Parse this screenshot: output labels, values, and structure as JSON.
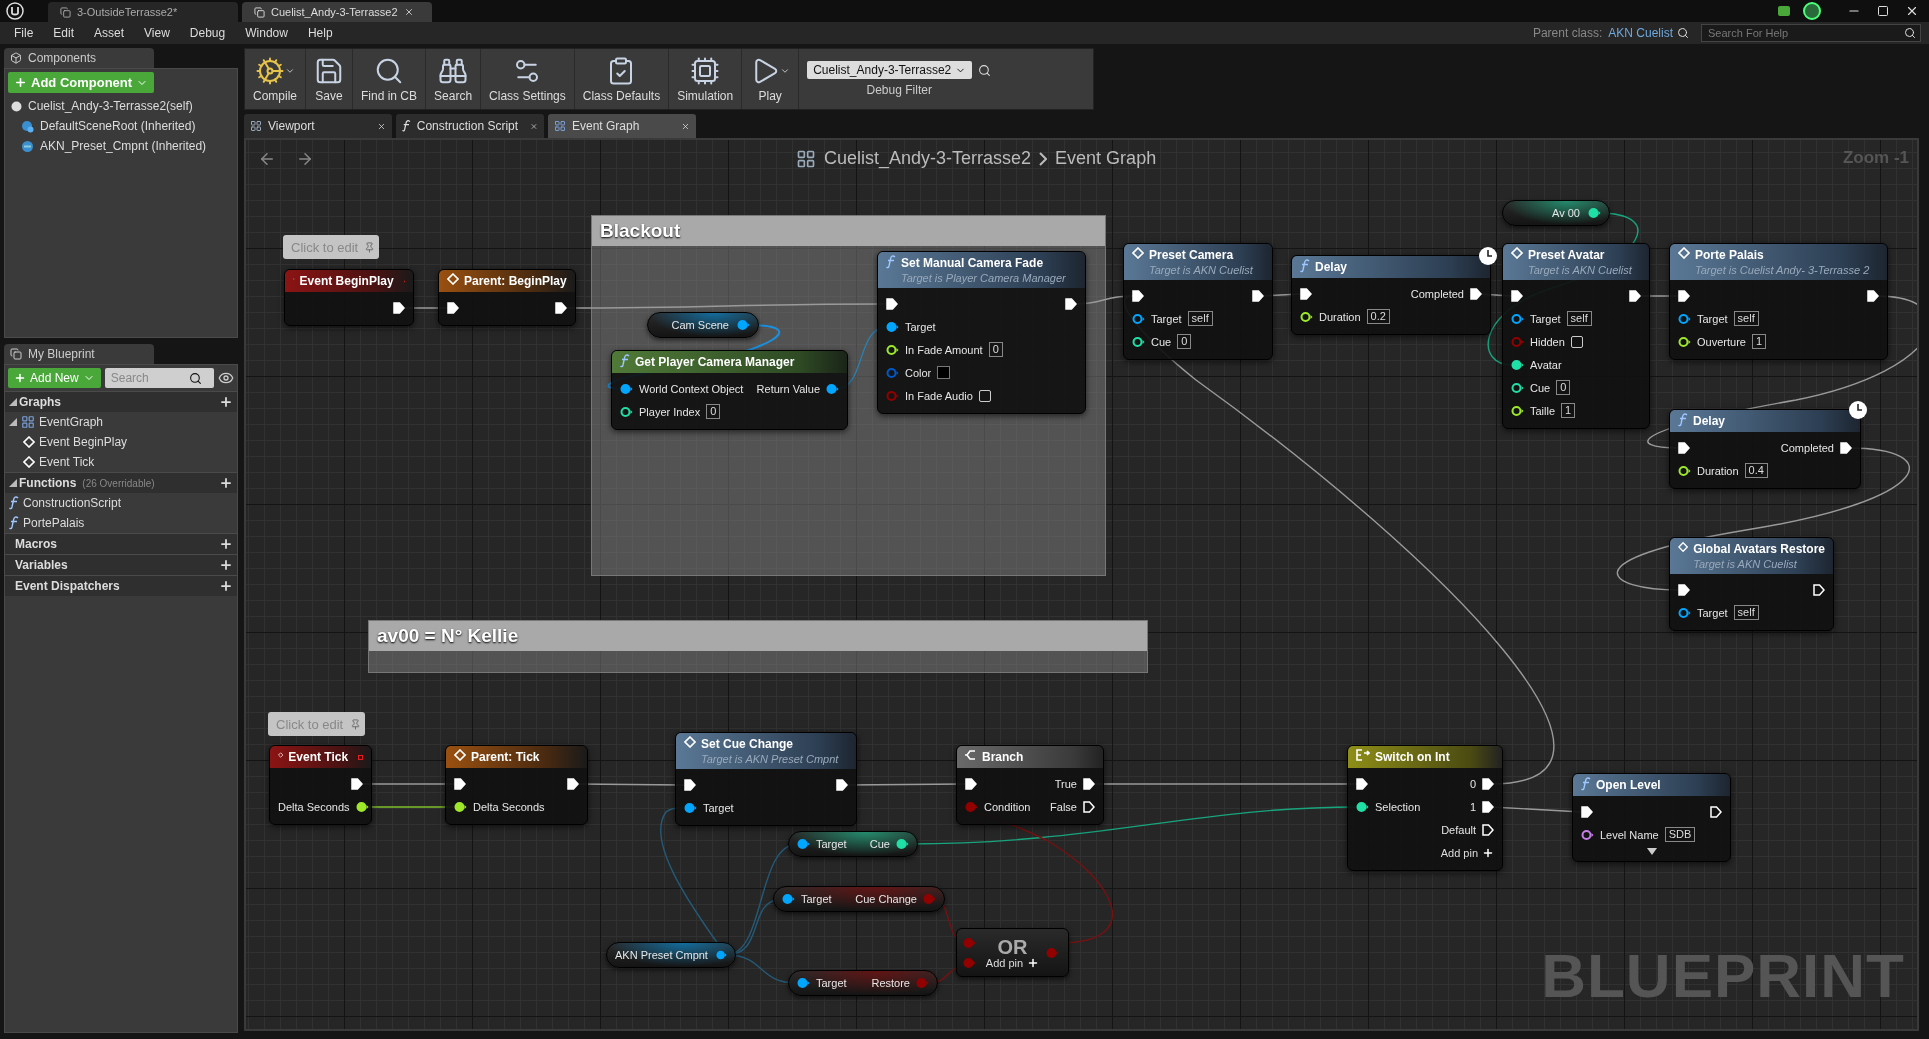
{
  "title_bar": {
    "tabs": [
      {
        "label": "3-OutsideTerrasse2*",
        "selected": false
      },
      {
        "label": "Cuelist_Andy-3-Terrasse2",
        "selected": true
      }
    ]
  },
  "menu": [
    "File",
    "Edit",
    "Asset",
    "View",
    "Debug",
    "Window",
    "Help"
  ],
  "parent_class": {
    "label": "Parent class:",
    "value": "AKN Cuelist"
  },
  "help_search": {
    "placeholder": "Search For Help"
  },
  "components": {
    "title": "Components",
    "add_button": "Add Component",
    "items": [
      {
        "label": "Cuelist_Andy-3-Terrasse2(self)",
        "kind": "self"
      },
      {
        "label": "DefaultSceneRoot (Inherited)",
        "kind": "scene"
      },
      {
        "label": "AKN_Preset_Cmpnt (Inherited)",
        "kind": "component"
      }
    ]
  },
  "my_blueprint": {
    "title": "My Blueprint",
    "add_button": "Add New",
    "search": {
      "placeholder": "Search"
    },
    "sections": [
      {
        "label": "Graphs",
        "expanded": true,
        "items": [
          {
            "label": "EventGraph",
            "kind": "graph",
            "expanded": true,
            "children": [
              {
                "label": "Event BeginPlay",
                "kind": "event"
              },
              {
                "label": "Event Tick",
                "kind": "event"
              }
            ]
          }
        ]
      },
      {
        "label": "Functions",
        "note": "(26 Overridable)",
        "expanded": true,
        "items": [
          {
            "label": "ConstructionScript",
            "kind": "construction"
          },
          {
            "label": "PortePalais",
            "kind": "function"
          }
        ]
      },
      {
        "label": "Macros",
        "expanded": false
      },
      {
        "label": "Variables",
        "expanded": false
      },
      {
        "label": "Event Dispatchers",
        "expanded": false
      }
    ]
  },
  "toolbar": [
    {
      "label": "Compile",
      "kind": "compile",
      "dropdown": true
    },
    {
      "label": "Save",
      "kind": "save",
      "dropdown": false
    },
    {
      "label": "Find in CB",
      "kind": "find",
      "dropdown": false
    },
    {
      "label": "Search",
      "kind": "search",
      "dropdown": false
    },
    {
      "label": "Class Settings",
      "kind": "settings",
      "dropdown": false
    },
    {
      "label": "Class Defaults",
      "kind": "defaults",
      "dropdown": false
    },
    {
      "label": "Simulation",
      "kind": "simulation",
      "dropdown": false
    },
    {
      "label": "Play",
      "kind": "play",
      "dropdown": true
    }
  ],
  "debug_filter": {
    "value": "Cuelist_Andy-3-Terrasse2",
    "label": "Debug Filter"
  },
  "graph_tabs": [
    {
      "label": "Viewport",
      "kind": "viewport",
      "selected": false
    },
    {
      "label": "Construction Script",
      "kind": "function",
      "selected": false
    },
    {
      "label": "Event Graph",
      "kind": "graph",
      "selected": true
    }
  ],
  "graph": {
    "breadcrumb": [
      "Cuelist_Andy-3-Terrasse2",
      "Event Graph"
    ],
    "zoom": "Zoom -1",
    "watermark": "BLUEPRINT",
    "comments": [
      {
        "title": "Blackout"
      },
      {
        "title": "av00 =  N° Kellie"
      }
    ],
    "bubbles": [
      {
        "text": "Click to edit"
      },
      {
        "text": "Click to edit"
      }
    ],
    "nodes": [
      {
        "kind": "event",
        "title": "Event BeginPlay",
        "rows": [
          {
            "right": {
              "kind": "exec",
              "connected": true
            }
          }
        ]
      },
      {
        "kind": "parent",
        "title": "Parent: BeginPlay",
        "rows": [
          {
            "left": {
              "kind": "exec",
              "connected": true
            },
            "right": {
              "kind": "exec",
              "connected": true
            }
          }
        ]
      },
      {
        "kind": "variable",
        "title": "Cam Scene",
        "output": {
          "kind": "data",
          "color": "#00a6ff",
          "connected": true
        }
      },
      {
        "kind": "pure",
        "title": "Get Player Camera Manager",
        "rows": [
          {
            "left": {
              "kind": "data",
              "label": "World Context Object",
              "color": "#00a6ff",
              "connected": true
            },
            "right": {
              "kind": "data",
              "label": "Return Value",
              "color": "#00a6ff",
              "connected": true
            }
          },
          {
            "left": {
              "kind": "data",
              "label": "Player Index",
              "color": "#1fe0a6",
              "connected": false,
              "value": "0"
            }
          }
        ]
      },
      {
        "kind": "function_call",
        "title": "Set Manual Camera Fade",
        "subtitle": "Target is Player Camera Manager",
        "rows": [
          {
            "left": {
              "kind": "exec",
              "connected": true
            },
            "right": {
              "kind": "exec",
              "connected": true
            }
          },
          {
            "left": {
              "kind": "data",
              "label": "Target",
              "color": "#00a6ff",
              "connected": true
            }
          },
          {
            "left": {
              "kind": "data",
              "label": "In Fade Amount",
              "color": "#9ee82a",
              "connected": false,
              "value": "0"
            }
          },
          {
            "left": {
              "kind": "data",
              "label": "Color",
              "color": "#0058c8",
              "connected": false,
              "default": {
                "color": "#000000"
              }
            }
          },
          {
            "left": {
              "kind": "data",
              "label": "In Fade Audio",
              "color": "#930000",
              "connected": false,
              "checked": false
            }
          }
        ]
      },
      {
        "kind": "event_call",
        "title": "Preset Camera",
        "subtitle": "Target is AKN Cuelist",
        "rows": [
          {
            "left": {
              "kind": "exec",
              "connected": true
            },
            "right": {
              "kind": "exec",
              "connected": true
            }
          },
          {
            "left": {
              "kind": "data",
              "label": "Target",
              "color": "#00a6ff",
              "connected": false,
              "value": "self"
            }
          },
          {
            "left": {
              "kind": "data",
              "label": "Cue",
              "color": "#1fe0a6",
              "connected": false,
              "value": "0"
            }
          }
        ]
      },
      {
        "kind": "function_call",
        "title": "Delay",
        "latent": true,
        "rows": [
          {
            "left": {
              "kind": "exec",
              "connected": true
            },
            "right": {
              "kind": "exec",
              "label": "Completed",
              "connected": true
            }
          },
          {
            "left": {
              "kind": "data",
              "label": "Duration",
              "color": "#9ee82a",
              "connected": false,
              "value": "0.2"
            }
          }
        ]
      },
      {
        "kind": "variable",
        "title": "Av 00",
        "output": {
          "kind": "data",
          "color": "#1fe0a6",
          "connected": true
        }
      },
      {
        "kind": "event_call",
        "title": "Preset Avatar",
        "subtitle": "Target is AKN Cuelist",
        "rows": [
          {
            "left": {
              "kind": "exec",
              "connected": true
            },
            "right": {
              "kind": "exec",
              "connected": true
            }
          },
          {
            "left": {
              "kind": "data",
              "label": "Target",
              "color": "#00a6ff",
              "connected": false,
              "value": "self"
            }
          },
          {
            "left": {
              "kind": "data",
              "label": "Hidden",
              "color": "#930000",
              "connected": false,
              "checked": false
            }
          },
          {
            "left": {
              "kind": "data",
              "label": "Avatar",
              "color": "#1fe0a6",
              "connected": true
            }
          },
          {
            "left": {
              "kind": "data",
              "label": "Cue",
              "color": "#1fe0a6",
              "connected": false,
              "value": "0"
            }
          },
          {
            "left": {
              "kind": "data",
              "label": "Taille",
              "color": "#9ee82a",
              "connected": false,
              "value": "1"
            }
          }
        ]
      },
      {
        "kind": "event_call",
        "title": "Porte Palais",
        "subtitle": "Target is Cuelist Andy- 3-Terrasse 2",
        "rows": [
          {
            "left": {
              "kind": "exec",
              "connected": true
            },
            "right": {
              "kind": "exec",
              "connected": true
            }
          },
          {
            "left": {
              "kind": "data",
              "label": "Target",
              "color": "#00a6ff",
              "connected": false,
              "value": "self"
            }
          },
          {
            "left": {
              "kind": "data",
              "label": "Ouverture",
              "color": "#9ee82a",
              "connected": false,
              "value": "1"
            }
          }
        ]
      },
      {
        "kind": "function_call",
        "title": "Delay",
        "latent": true,
        "rows": [
          {
            "left": {
              "kind": "exec",
              "connected": true
            },
            "right": {
              "kind": "exec",
              "label": "Completed",
              "connected": true
            }
          },
          {
            "left": {
              "kind": "data",
              "label": "Duration",
              "color": "#9ee82a",
              "connected": false,
              "value": "0.4"
            }
          }
        ]
      },
      {
        "kind": "event_call",
        "title": "Global Avatars Restore",
        "subtitle": "Target is AKN Cuelist",
        "rows": [
          {
            "left": {
              "kind": "exec",
              "connected": true
            },
            "right": {
              "kind": "exec",
              "connected": false
            }
          },
          {
            "left": {
              "kind": "data",
              "label": "Target",
              "color": "#00a6ff",
              "connected": false,
              "value": "self"
            }
          }
        ]
      },
      {
        "kind": "event",
        "title": "Event Tick",
        "rows": [
          {
            "right": {
              "kind": "exec",
              "connected": true
            }
          },
          {
            "right": {
              "kind": "data",
              "label": "Delta Seconds",
              "color": "#9ee82a",
              "connected": true
            }
          }
        ]
      },
      {
        "kind": "parent",
        "title": "Parent: Tick",
        "rows": [
          {
            "left": {
              "kind": "exec",
              "connected": true
            },
            "right": {
              "kind": "exec",
              "connected": true
            }
          },
          {
            "left": {
              "kind": "data",
              "label": "Delta Seconds",
              "color": "#9ee82a",
              "connected": true
            }
          }
        ]
      },
      {
        "kind": "event_call",
        "title": "Set Cue Change",
        "subtitle": "Target is AKN Preset Cmpnt",
        "rows": [
          {
            "left": {
              "kind": "exec",
              "connected": true
            },
            "right": {
              "kind": "exec",
              "connected": true
            }
          },
          {
            "left": {
              "kind": "data",
              "label": "Target",
              "color": "#00a6ff",
              "connected": true
            }
          }
        ]
      },
      {
        "kind": "macro",
        "title": "Branch",
        "rows": [
          {
            "left": {
              "kind": "exec",
              "connected": true
            },
            "right": {
              "kind": "exec",
              "label": "True",
              "connected": true
            }
          },
          {
            "left": {
              "kind": "data",
              "label": "Condition",
              "color": "#930000",
              "connected": true
            },
            "right": {
              "kind": "exec",
              "label": "False",
              "connected": false
            }
          }
        ]
      },
      {
        "kind": "switch",
        "title": "Switch on Int",
        "rows": [
          {
            "left": {
              "kind": "exec",
              "connected": true
            },
            "right": {
              "kind": "exec",
              "label": "0",
              "connected": true
            }
          },
          {
            "left": {
              "kind": "data",
              "label": "Selection",
              "color": "#1fe0a6",
              "connected": true
            },
            "right": {
              "kind": "exec",
              "label": "1",
              "connected": true
            }
          },
          {
            "right": {
              "kind": "exec",
              "label": "Default",
              "connected": false
            }
          },
          {
            "right": {
              "kind": "add",
              "label": "Add pin"
            }
          }
        ]
      },
      {
        "kind": "function_call",
        "title": "Open Level",
        "advanced": true,
        "rows": [
          {
            "left": {
              "kind": "exec",
              "connected": true
            },
            "right": {
              "kind": "exec",
              "connected": false
            }
          },
          {
            "left": {
              "kind": "data",
              "label": "Level Name",
              "color": "#c87ee8",
              "connected": false,
              "value": "SDB"
            }
          }
        ]
      },
      {
        "kind": "getter",
        "input": {
          "kind": "data",
          "label": "Target",
          "color": "#00a6ff",
          "connected": true
        },
        "output": {
          "kind": "data",
          "label": "Cue",
          "color": "#1fe0a6",
          "connected": true
        }
      },
      {
        "kind": "getter",
        "input": {
          "kind": "data",
          "label": "Target",
          "color": "#00a6ff",
          "connected": true
        },
        "output": {
          "kind": "data",
          "label": "Cue Change",
          "color": "#930000",
          "connected": true
        }
      },
      {
        "kind": "variable",
        "title": "AKN Preset Cmpnt",
        "output": {
          "kind": "data",
          "color": "#00a6ff",
          "connected": true
        }
      },
      {
        "kind": "getter",
        "input": {
          "kind": "data",
          "label": "Target",
          "color": "#00a6ff",
          "connected": true
        },
        "output": {
          "kind": "data",
          "label": "Restore",
          "color": "#930000",
          "connected": true
        }
      },
      {
        "kind": "or",
        "title": "OR",
        "inputs": [
          {
            "kind": "data",
            "color": "#930000",
            "connected": true
          },
          {
            "kind": "data",
            "color": "#930000",
            "connected": true
          }
        ],
        "output": {
          "kind": "data",
          "color": "#930000",
          "connected": true
        },
        "add": {
          "kind": "add",
          "label": "Add pin"
        }
      }
    ]
  }
}
